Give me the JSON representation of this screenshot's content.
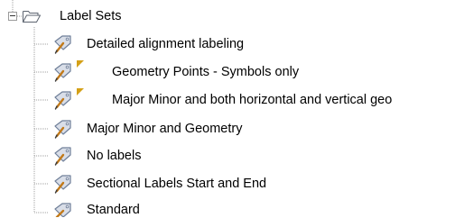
{
  "tree": {
    "root": {
      "label": "Label Sets",
      "icon": "folder-open-icon",
      "expanded": true
    },
    "items": [
      {
        "label": "Detailed alignment labeling",
        "icon": "label-set-icon",
        "modified": false
      },
      {
        "label": "Geometry Points -  Symbols only",
        "icon": "label-set-icon",
        "modified": true
      },
      {
        "label": "Major Minor and both horizontal and vertical geo",
        "icon": "label-set-icon",
        "modified": true
      },
      {
        "label": "Major Minor and Geometry",
        "icon": "label-set-icon",
        "modified": false
      },
      {
        "label": "No labels",
        "icon": "label-set-icon",
        "modified": false
      },
      {
        "label": "Sectional Labels Start and End",
        "icon": "label-set-icon",
        "modified": false
      },
      {
        "label": "Standard",
        "icon": "label-set-icon",
        "modified": false
      }
    ]
  },
  "colors": {
    "tree_line": "#a0a0a0",
    "modified_marker": "#d4a017",
    "icon_body": "#d9dee8",
    "icon_outline": "#6f7f99",
    "pencil": "#c27a1a"
  }
}
